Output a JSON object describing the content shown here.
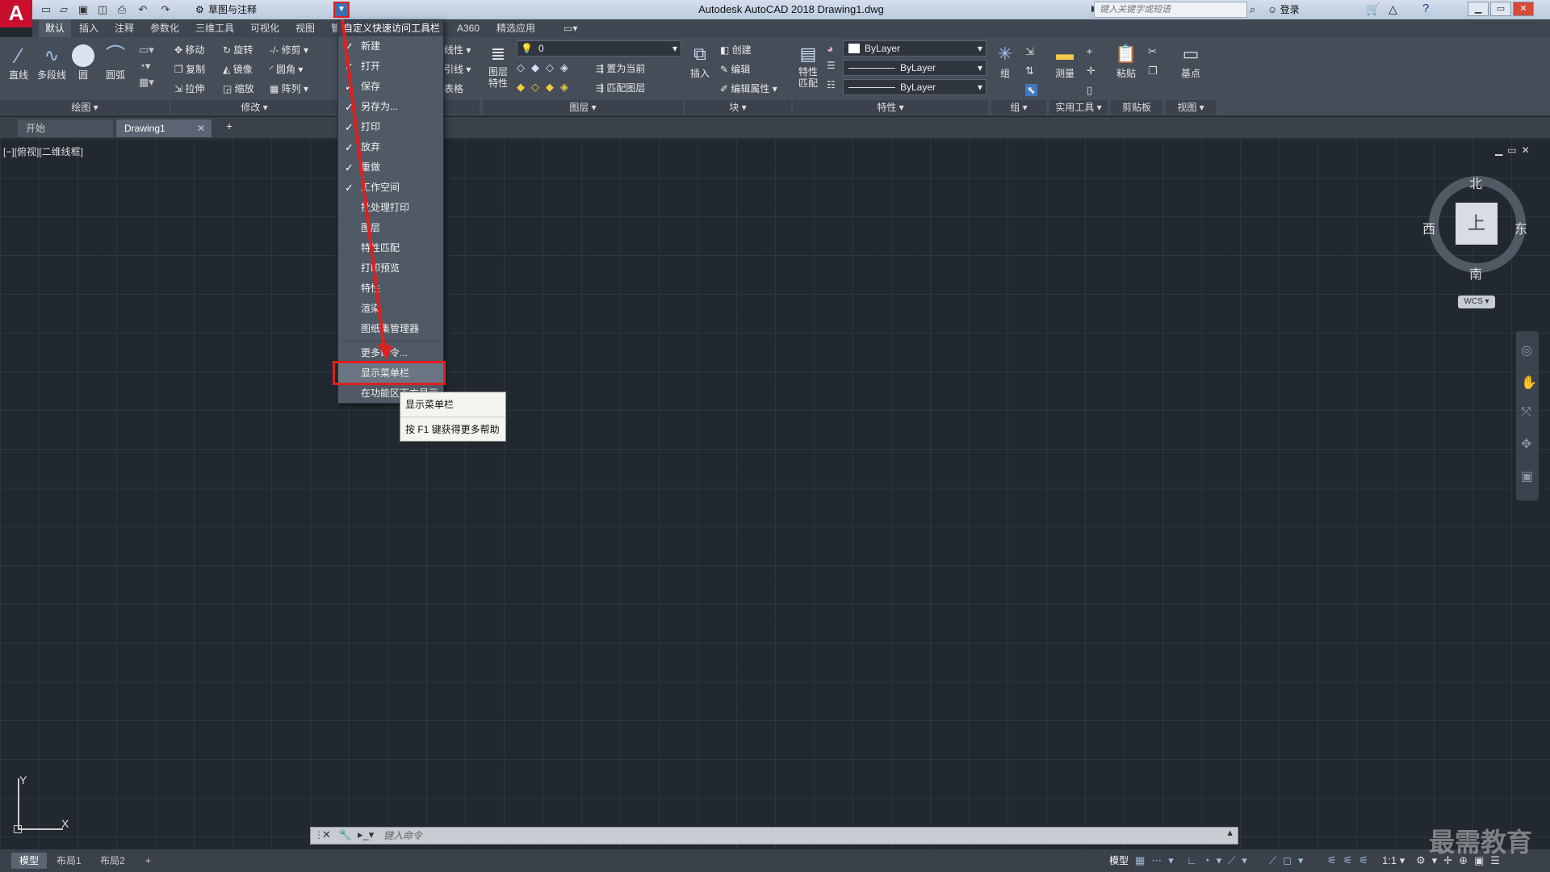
{
  "app": {
    "logo": "A",
    "title": "Autodesk AutoCAD 2018    Drawing1.dwg"
  },
  "qat": {
    "workspace": "草图与注释"
  },
  "search": {
    "placeholder": "键入关键字或短语"
  },
  "user": {
    "login": "登录"
  },
  "ribbon": {
    "tabs": [
      "默认",
      "插入",
      "注释",
      "参数化",
      "三维工具",
      "可视化",
      "视图",
      "管",
      "A360",
      "精选应用"
    ],
    "draw": {
      "title": "绘图",
      "line": "直线",
      "polyline": "多段线",
      "circle": "圆",
      "arc": "圆弧"
    },
    "modify": {
      "title": "修改",
      "move": "移动",
      "rotate": "旋转",
      "trim": "修剪",
      "copy": "复制",
      "mirror": "镜像",
      "fillet": "圆角",
      "stretch": "拉伸",
      "scale": "缩放",
      "array": "阵列"
    },
    "annot": {
      "linear": "线性",
      "leader": "引线",
      "table": "表格"
    },
    "layers": {
      "title": "图层",
      "props": "图层\n特性",
      "current_layer": "0",
      "set_current": "置为当前",
      "match_layer": "匹配图层"
    },
    "block": {
      "title": "块",
      "insert": "插入",
      "create": "创建",
      "edit": "编辑",
      "edit_attr": "编辑属性"
    },
    "properties": {
      "title": "特性",
      "match": "特性\n匹配",
      "color": "ByLayer",
      "linetype": "ByLayer",
      "lineweight": "ByLayer"
    },
    "group": {
      "title": "组",
      "group": "组"
    },
    "utilities": {
      "title": "实用工具",
      "measure": "测量"
    },
    "clipboard": {
      "title": "剪贴板",
      "paste": "粘贴"
    },
    "view": {
      "title": "视图",
      "base": "基点"
    }
  },
  "doctabs": {
    "start": "开始",
    "drawing": "Drawing1",
    "add": "+"
  },
  "viewport": {
    "label": "[−][俯视][二维线框]"
  },
  "viewcube": {
    "north": "北",
    "south": "南",
    "east": "东",
    "west": "西",
    "face": "上",
    "wcs": "WCS"
  },
  "ucs": {
    "x": "X",
    "y": "Y"
  },
  "cmd": {
    "placeholder": "键入命令"
  },
  "qat_menu": {
    "header": "自定义快速访问工具栏",
    "items": [
      {
        "label": "新建",
        "checked": true
      },
      {
        "label": "打开",
        "checked": true
      },
      {
        "label": "保存",
        "checked": true
      },
      {
        "label": "另存为...",
        "checked": true
      },
      {
        "label": "打印",
        "checked": true
      },
      {
        "label": "放弃",
        "checked": true
      },
      {
        "label": "重做",
        "checked": true
      },
      {
        "label": "工作空间",
        "checked": true
      },
      {
        "label": "批处理打印",
        "checked": false
      },
      {
        "label": "图层",
        "checked": false
      },
      {
        "label": "特性匹配",
        "checked": false
      },
      {
        "label": "打印预览",
        "checked": false
      },
      {
        "label": "特性",
        "checked": false
      },
      {
        "label": "渲染",
        "checked": false
      },
      {
        "label": "图纸集管理器",
        "checked": false
      }
    ],
    "more": "更多命令...",
    "show_menubar": "显示菜单栏",
    "show_below": "在功能区下方显示"
  },
  "tooltip": {
    "title": "显示菜单栏",
    "help": "按 F1 键获得更多帮助"
  },
  "status": {
    "model": "模型",
    "layout1": "布局1",
    "layout2": "布局2",
    "add": "+",
    "model_btn": "模型",
    "scale": "1:1"
  },
  "watermark": "最需教育",
  "colors": {
    "highlight": "#e02020",
    "canvas": "#212830"
  }
}
